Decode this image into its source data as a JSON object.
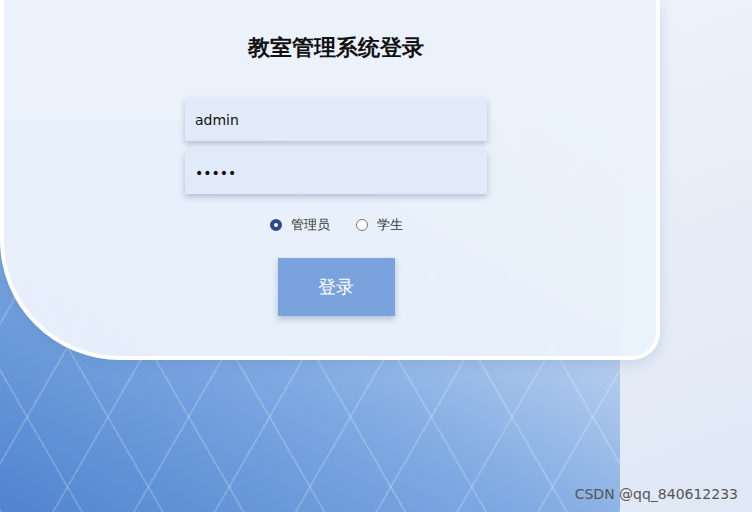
{
  "title": "教室管理系统登录",
  "fields": [
    {
      "value": "admin"
    },
    {
      "value": "•••••"
    }
  ],
  "roles": [
    {
      "label": "管理员",
      "selected": true
    },
    {
      "label": "学生",
      "selected": false
    }
  ],
  "login_button": "登录",
  "watermark": "CSDN @qq_840612233"
}
